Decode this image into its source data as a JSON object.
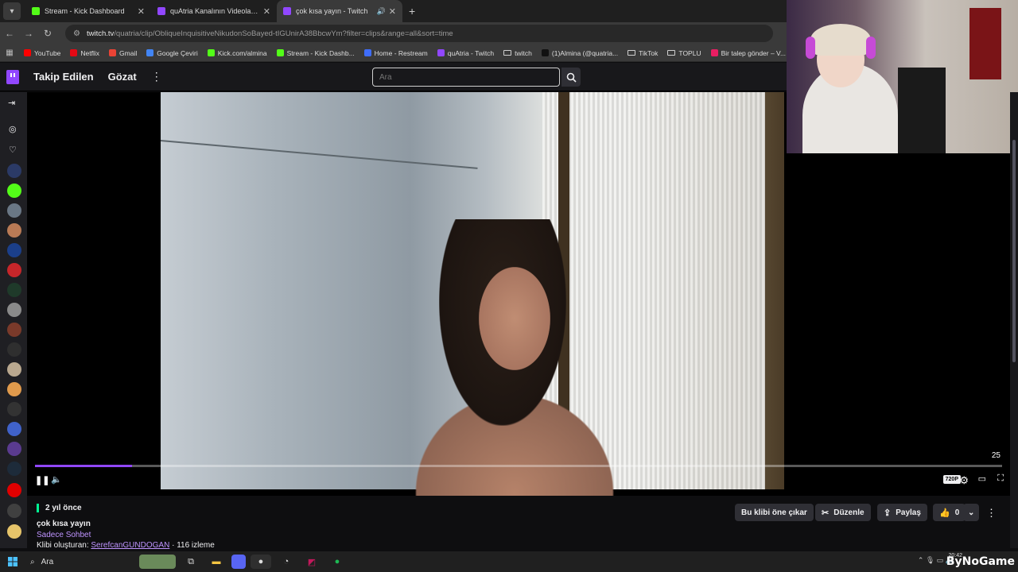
{
  "browser": {
    "tabs": [
      {
        "title": "Stream - Kick Dashboard",
        "color": "#53fc18",
        "active": false
      },
      {
        "title": "quAtria Kanalının Videoları - Tw",
        "color": "#9147ff",
        "active": false
      },
      {
        "title": "çok kısa yayın - Twitch",
        "color": "#9147ff",
        "active": true
      }
    ],
    "url_host": "twitch.tv",
    "url_path": "/quatria/clip/ObliqueInquisitiveNikudonSoBayed-tIGUnirA38BbcwYm?filter=clips&range=all&sort=time",
    "bookmarks": [
      {
        "label": "YouTube",
        "color": "#ff0000"
      },
      {
        "label": "Netflix",
        "color": "#e50914"
      },
      {
        "label": "Gmail",
        "color": "#ea4335"
      },
      {
        "label": "Google Çeviri",
        "color": "#4285f4"
      },
      {
        "label": "Kick.com/almina",
        "color": "#53fc18"
      },
      {
        "label": "Stream - Kick Dashb...",
        "color": "#53fc18"
      },
      {
        "label": "Home - Restream",
        "color": "#3f6dfb"
      },
      {
        "label": "quAtria - Twitch",
        "color": "#9147ff"
      },
      {
        "label": "twitch",
        "color": "folder"
      },
      {
        "label": "(1)Almina (@quatria...",
        "color": "#111111"
      },
      {
        "label": "TikTok",
        "color": "folder"
      },
      {
        "label": "TOPLU",
        "color": "folder"
      },
      {
        "label": "Bir talep gönder – V...",
        "color": "#e91e63"
      }
    ]
  },
  "twitch": {
    "nav_following": "Takip Edilen",
    "nav_browse": "Gözat",
    "search_placeholder": "Ara",
    "accent": "#9147ff"
  },
  "player": {
    "time_remaining": "25",
    "progress_fraction": 0.1,
    "quality": "720P"
  },
  "clip": {
    "age": "2 yıl önce",
    "title": "çok kısa yayın",
    "category": "Sadece Sohbet",
    "creator_prefix": "Klibi oluşturan:",
    "creator_name": "SerefcanGUNDOGAN",
    "views": "116 izleme",
    "buttons": {
      "feature": "Bu klibi öne çıkar",
      "edit": "Düzenle",
      "share": "Paylaş",
      "likes": "0"
    }
  },
  "taskbar": {
    "search_label": "Ara",
    "clock": "20:42",
    "watermark": "ByNoGame"
  }
}
